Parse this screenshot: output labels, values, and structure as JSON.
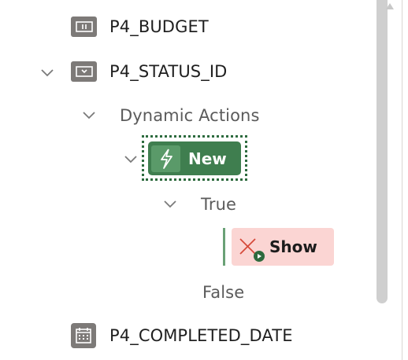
{
  "tree": {
    "items": [
      {
        "label": "P4_BUDGET",
        "icon": "number-field-icon"
      },
      {
        "label": "P4_STATUS_ID",
        "icon": "select-list-icon"
      },
      {
        "label": "Dynamic Actions",
        "icon": "chevron-down-icon"
      },
      {
        "label": "New",
        "icon": "lightning-bolt-icon"
      },
      {
        "label": "True",
        "icon": "chevron-down-icon"
      },
      {
        "label": "Show",
        "icon": "close-x-icon"
      },
      {
        "label": "False"
      },
      {
        "label": "P4_COMPLETED_DATE",
        "icon": "calendar-icon"
      }
    ]
  },
  "colors": {
    "dynamic_action_chip": "#3f7e4f",
    "true_action_chip": "#fbd5d3",
    "item_icon": "#7d7a78",
    "scrollbar": "#cfcfcf"
  }
}
